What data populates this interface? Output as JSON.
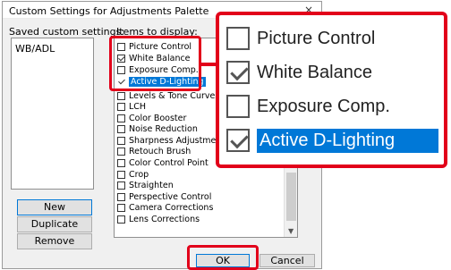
{
  "window": {
    "title": "Custom Settings for Adjustments Palette",
    "close_glyph": "×"
  },
  "saved": {
    "label": "Saved custom settings:",
    "items": [
      "WB/ADL"
    ]
  },
  "items_label": "Items to display:",
  "items": [
    {
      "label": "Picture Control",
      "checked": false
    },
    {
      "label": "White Balance",
      "checked": true
    },
    {
      "label": "Exposure Comp.",
      "checked": false
    },
    {
      "label": "Active D-Lighting",
      "checked": true,
      "selected": true
    },
    {
      "label": "Levels & Tone Curves",
      "checked": false
    },
    {
      "label": "LCH",
      "checked": false
    },
    {
      "label": "Color Booster",
      "checked": false
    },
    {
      "label": "Noise Reduction",
      "checked": false
    },
    {
      "label": "Sharpness Adjustment",
      "checked": false
    },
    {
      "label": "Retouch Brush",
      "checked": false
    },
    {
      "label": "Color Control Point",
      "checked": false
    },
    {
      "label": "Crop",
      "checked": false
    },
    {
      "label": "Straighten",
      "checked": false
    },
    {
      "label": "Perspective Control",
      "checked": false
    },
    {
      "label": "Camera Corrections",
      "checked": false
    },
    {
      "label": "Lens Corrections",
      "checked": false
    }
  ],
  "buttons": {
    "new": "New",
    "duplicate": "Duplicate",
    "remove": "Remove",
    "ok": "OK",
    "cancel": "Cancel"
  },
  "zoom": [
    {
      "label": "Picture Control",
      "checked": false
    },
    {
      "label": "White Balance",
      "checked": true
    },
    {
      "label": "Exposure Comp.",
      "checked": false
    },
    {
      "label": "Active D-Lighting",
      "checked": true,
      "selected": true
    }
  ],
  "colors": {
    "highlight": "#e2001a",
    "selection": "#0078d7"
  }
}
